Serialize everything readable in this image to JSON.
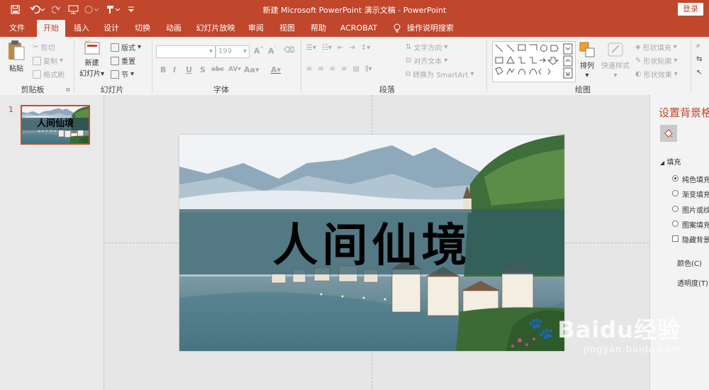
{
  "window": {
    "title": "新建 Microsoft PowerPoint 演示文稿  -  PowerPoint",
    "login_label": "登录"
  },
  "quick_access": [
    {
      "icon": "save-icon",
      "glyph": "🖫"
    },
    {
      "icon": "undo-icon",
      "glyph": "↶"
    },
    {
      "icon": "redo-icon",
      "glyph": "↻"
    },
    {
      "icon": "start-from-beginning-icon",
      "glyph": "⧉"
    },
    {
      "icon": "touch-mode-icon",
      "glyph": "⊘"
    },
    {
      "icon": "format-painter-qa-icon",
      "glyph": "⊫"
    },
    {
      "icon": "customize-toolbar-icon",
      "glyph": "▾"
    }
  ],
  "tabs": [
    "文件",
    "开始",
    "插入",
    "设计",
    "切换",
    "动画",
    "幻灯片放映",
    "审阅",
    "视图",
    "帮助",
    "ACROBAT",
    "操作说明搜索"
  ],
  "active_tab": "开始",
  "ribbon": {
    "clipboard": {
      "label": "剪贴板",
      "paste": "粘贴",
      "cut": "剪切",
      "copy": "复制",
      "format_painter": "格式刷"
    },
    "slides": {
      "label": "幻灯片",
      "new_slide_line1": "新建",
      "new_slide_line2": "幻灯片",
      "layout": "版式",
      "reset": "重置",
      "section": "节"
    },
    "font": {
      "label": "字体",
      "font_name": "",
      "font_size": "199",
      "bold": "B",
      "italic": "I",
      "underline": "U",
      "shadow": "S",
      "strike": "abc",
      "spacing": "AV",
      "case": "Aa",
      "color": "A"
    },
    "paragraph": {
      "label": "段落",
      "text_direction": "文字方向",
      "align_text": "对齐文本",
      "convert_smartart": "转换为 SmartArt"
    },
    "drawing": {
      "label": "绘图",
      "arrange": "排列",
      "quick_styles": "快速样式",
      "shape_fill": "形状填充",
      "shape_outline": "形状轮廓",
      "shape_effects": "形状效果"
    }
  },
  "slides_panel": {
    "slide_number": "1",
    "thumb_title": "人间仙境"
  },
  "slide": {
    "title": "人间仙境"
  },
  "format_pane": {
    "title": "设置背景格式",
    "section": "填充",
    "options": [
      {
        "label": "纯色填充",
        "checked": true
      },
      {
        "label": "渐变填充",
        "checked": false
      },
      {
        "label": "图片或纹理填充",
        "checked": false
      },
      {
        "label": "图案填充",
        "checked": false
      }
    ],
    "hide_bg": "隐藏背景图形",
    "color_label": "颜色(C)",
    "transparency_label": "透明度(T)"
  },
  "watermark": {
    "brand": "Baidu经验",
    "url": "jingyan.baidu.com"
  },
  "colors": {
    "accent": "#c0462c",
    "ribbon_bg": "#f3f3f3",
    "band": "#2f5c66"
  }
}
